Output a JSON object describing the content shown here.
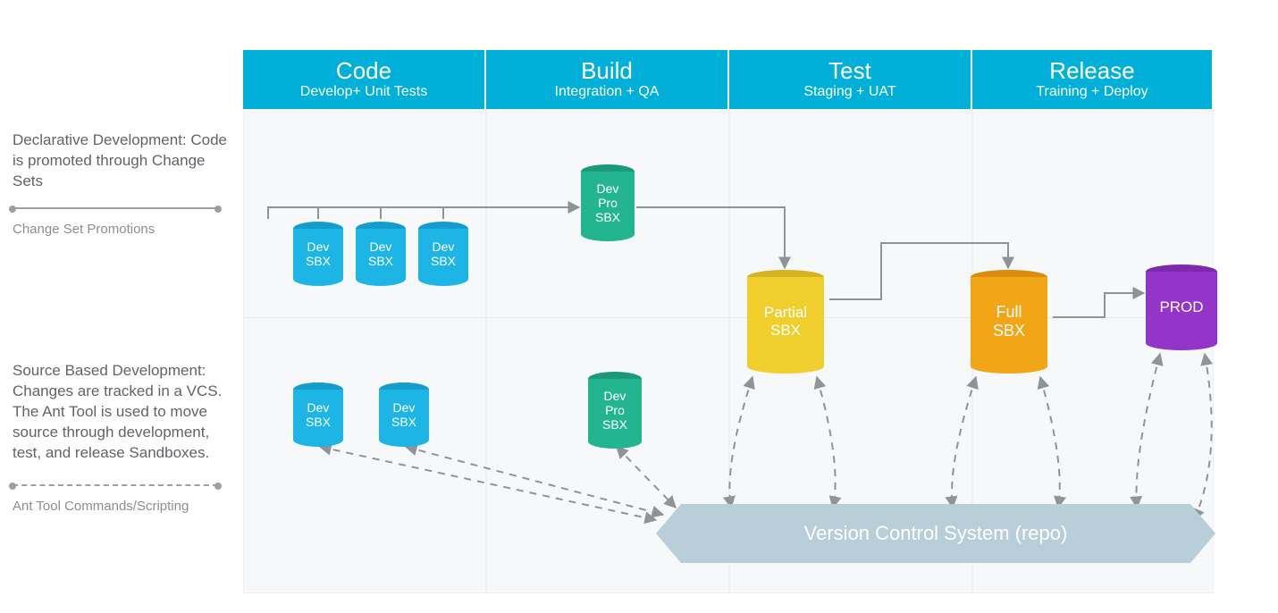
{
  "legend": {
    "declarative": {
      "text": "Declarative Development: Code is promoted through Change Sets",
      "caption": "Change Set Promotions"
    },
    "source": {
      "text": "Source Based Development: Changes are tracked in a VCS. The Ant Tool is used to move source through development, test, and release Sandboxes.",
      "caption": "Ant Tool Commands/Scripting"
    }
  },
  "columns": [
    {
      "title": "Code",
      "subtitle": "Develop+ Unit Tests"
    },
    {
      "title": "Build",
      "subtitle": "Integration + QA"
    },
    {
      "title": "Test",
      "subtitle": "Staging + UAT"
    },
    {
      "title": "Release",
      "subtitle": "Training + Deploy"
    }
  ],
  "nodes": {
    "dev1_top": {
      "label": "Dev\nSBX"
    },
    "dev2_top": {
      "label": "Dev\nSBX"
    },
    "dev3_top": {
      "label": "Dev\nSBX"
    },
    "devpro_top": {
      "label": "Dev\nPro\nSBX"
    },
    "partial": {
      "label": "Partial\nSBX"
    },
    "full": {
      "label": "Full\nSBX"
    },
    "prod": {
      "label": "PROD"
    },
    "dev1_bot": {
      "label": "Dev\nSBX"
    },
    "dev2_bot": {
      "label": "Dev\nSBX"
    },
    "devpro_bot": {
      "label": "Dev\nPro\nSBX"
    }
  },
  "vcs": {
    "label": "Version Control System (repo)"
  },
  "flows": {
    "change_set": [
      "Dev SBX (top row) → Dev Pro SBX",
      "Dev Pro SBX → Partial SBX",
      "Partial SBX → Full SBX",
      "Full SBX → PROD"
    ],
    "ant_tool": [
      "Dev SBX (bottom row) ↔ VCS",
      "Dev Pro SBX (bottom row) ↔ VCS",
      "Partial SBX ↔ VCS",
      "Full SBX ↔ VCS",
      "PROD ↔ VCS"
    ]
  },
  "colors": {
    "header": "#00b0d8",
    "dev_sbx": "#1db4e6",
    "dev_pro_sbx": "#22b58f",
    "partial_sbx": "#f0ce2d",
    "full_sbx": "#f2a515",
    "prod": "#9435c9",
    "vcs": "#b8cfd9",
    "flow": "#8f9498"
  }
}
